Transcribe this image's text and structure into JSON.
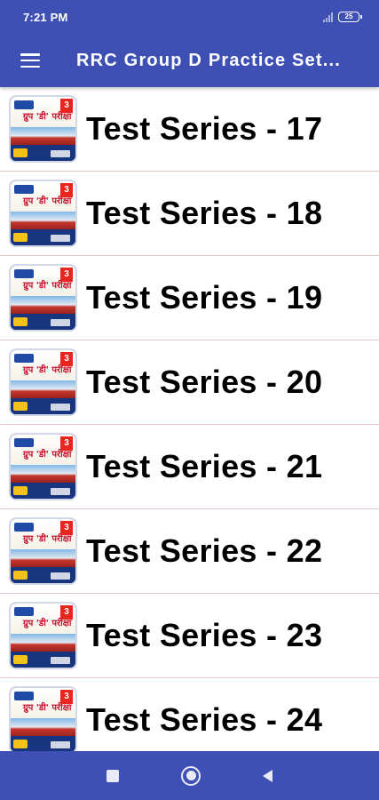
{
  "status_bar": {
    "time": "7:21 PM",
    "battery": "25"
  },
  "app_bar": {
    "title": "RRC Group D Practice Set...",
    "menu_icon": "hamburger-menu-icon"
  },
  "list": {
    "items": [
      {
        "label": "Test Series - 17"
      },
      {
        "label": "Test Series - 18"
      },
      {
        "label": "Test Series - 19"
      },
      {
        "label": "Test Series - 20"
      },
      {
        "label": "Test Series - 21"
      },
      {
        "label": "Test Series - 22"
      },
      {
        "label": "Test Series - 23"
      },
      {
        "label": "Test Series - 24"
      }
    ],
    "thumbnail": {
      "text": "ग्रुप 'डी' परीक्षा",
      "badge": "3"
    }
  },
  "nav_bar": {
    "icons": [
      "recents-square-icon",
      "home-circle-icon",
      "back-triangle-icon"
    ]
  },
  "colors": {
    "primary": "#3e50b4",
    "divider": "#e8c7c7",
    "text": "#000000"
  }
}
